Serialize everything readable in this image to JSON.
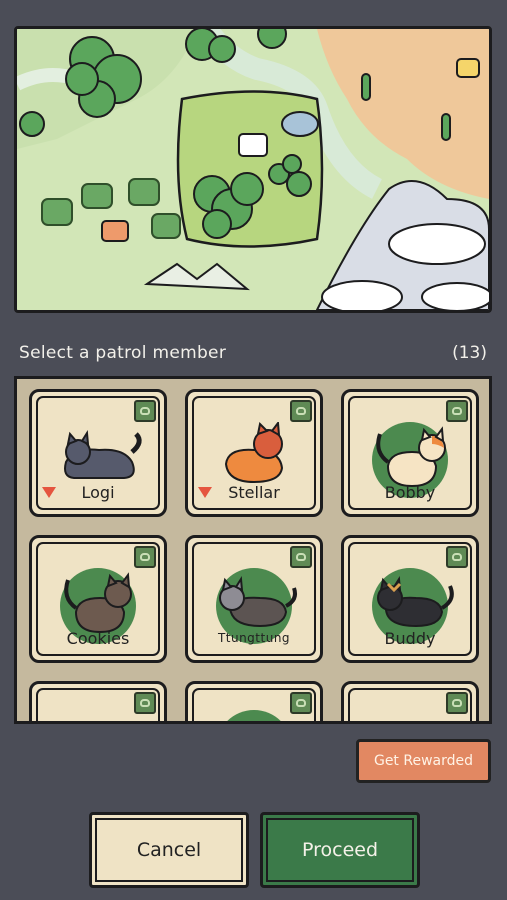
{
  "header": {
    "title": "Select a patrol member",
    "count": "(13)"
  },
  "cats": [
    {
      "name": "Logi",
      "indicator": "down-arrow",
      "highlighted": false
    },
    {
      "name": "Stellar",
      "indicator": "down-arrow",
      "highlighted": false
    },
    {
      "name": "Bobby",
      "indicator": "",
      "highlighted": true
    },
    {
      "name": "Cookies",
      "indicator": "",
      "highlighted": true
    },
    {
      "name": "Ttungttung",
      "indicator": "",
      "highlighted": true
    },
    {
      "name": "Buddy",
      "indicator": "",
      "highlighted": true
    }
  ],
  "buttons": {
    "reward": "Get Rewarded",
    "cancel": "Cancel",
    "proceed": "Proceed"
  },
  "colors": {
    "background": "#4b4d57",
    "accent_green": "#3b7a49",
    "accent_orange": "#e28862",
    "card": "#efe3c5"
  }
}
